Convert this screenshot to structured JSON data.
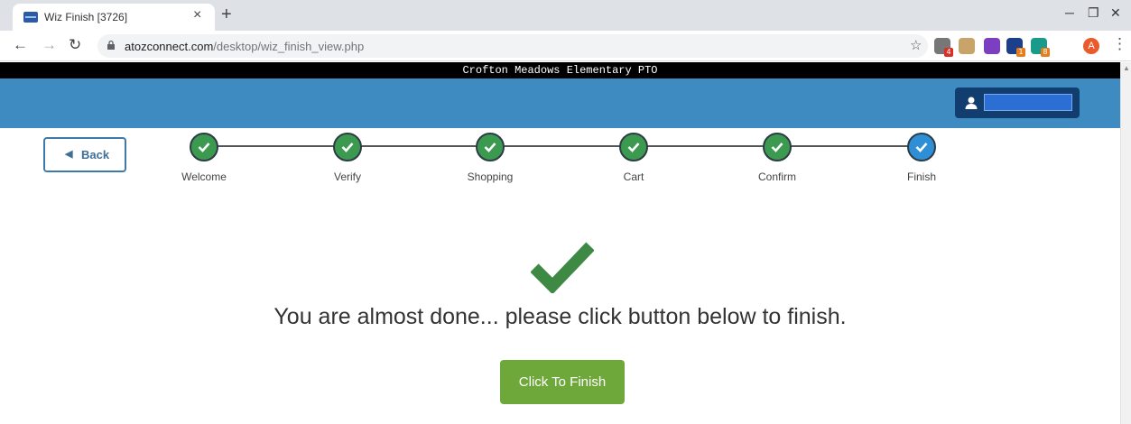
{
  "browser": {
    "tab_title": "Wiz Finish [3726]",
    "close_glyph": "×",
    "new_tab_glyph": "+",
    "url_host": "atozconnect.com",
    "url_path": "/desktop/wiz_finish_view.php",
    "extensions": [
      {
        "name": "ext-1",
        "color": "#777777",
        "badge": "4",
        "badge_color": "#d93025"
      },
      {
        "name": "ext-2",
        "color": "#c8a36a",
        "badge": "",
        "badge_color": ""
      },
      {
        "name": "ext-3",
        "color": "#7b3fbf",
        "badge": "",
        "badge_color": ""
      },
      {
        "name": "ext-4",
        "color": "#1b3f8b",
        "badge": "1",
        "badge_color": "#e67c1a"
      },
      {
        "name": "ext-5",
        "color": "#1a9a8a",
        "badge": "8",
        "badge_color": "#e67c1a"
      }
    ],
    "avatar_letter": "A"
  },
  "page": {
    "org_name": "Crofton Meadows Elementary PTO",
    "back_label": "Back",
    "steps": [
      {
        "label": "Welcome",
        "state": "done"
      },
      {
        "label": "Verify",
        "state": "done"
      },
      {
        "label": "Shopping",
        "state": "done"
      },
      {
        "label": "Cart",
        "state": "done"
      },
      {
        "label": "Confirm",
        "state": "done"
      },
      {
        "label": "Finish",
        "state": "current"
      }
    ],
    "message": "You are almost done... please click button below to finish.",
    "finish_button": "Click To Finish"
  },
  "colors": {
    "done_step": "#3b9a4f",
    "current_step": "#2e8fd6",
    "header_blue": "#3d8bc0",
    "finish_green": "#6fa83a",
    "checkmark_green": "#3e8a44"
  }
}
